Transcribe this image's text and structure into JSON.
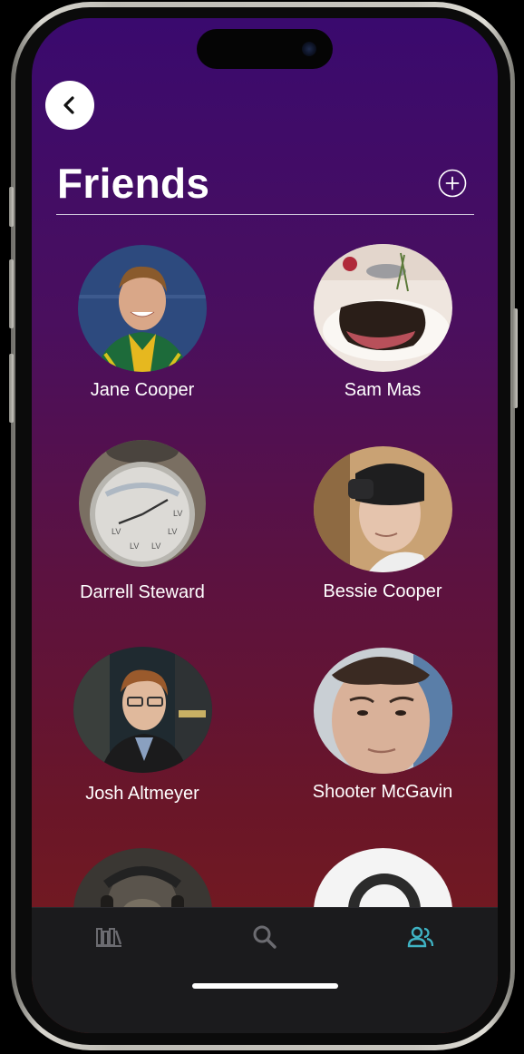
{
  "header": {
    "title": "Friends"
  },
  "friends": [
    {
      "name": "Jane Cooper"
    },
    {
      "name": "Sam Mas"
    },
    {
      "name": "Darrell Steward"
    },
    {
      "name": "Bessie Cooper"
    },
    {
      "name": "Josh Altmeyer"
    },
    {
      "name": "Shooter McGavin"
    }
  ],
  "icons": {
    "back": "chevron-left-icon",
    "add": "plus-circle-icon",
    "tab_library": "library-icon",
    "tab_search": "search-icon",
    "tab_friends": "friends-icon"
  },
  "colors": {
    "background_top": "#3a0a6e",
    "background_bottom": "#7a1d1a",
    "tab_active": "#3fb3c4",
    "tab_inactive": "#6b6b70",
    "tabbar": "#1b1b1d"
  },
  "tabbar": {
    "active_tab": "friends"
  }
}
